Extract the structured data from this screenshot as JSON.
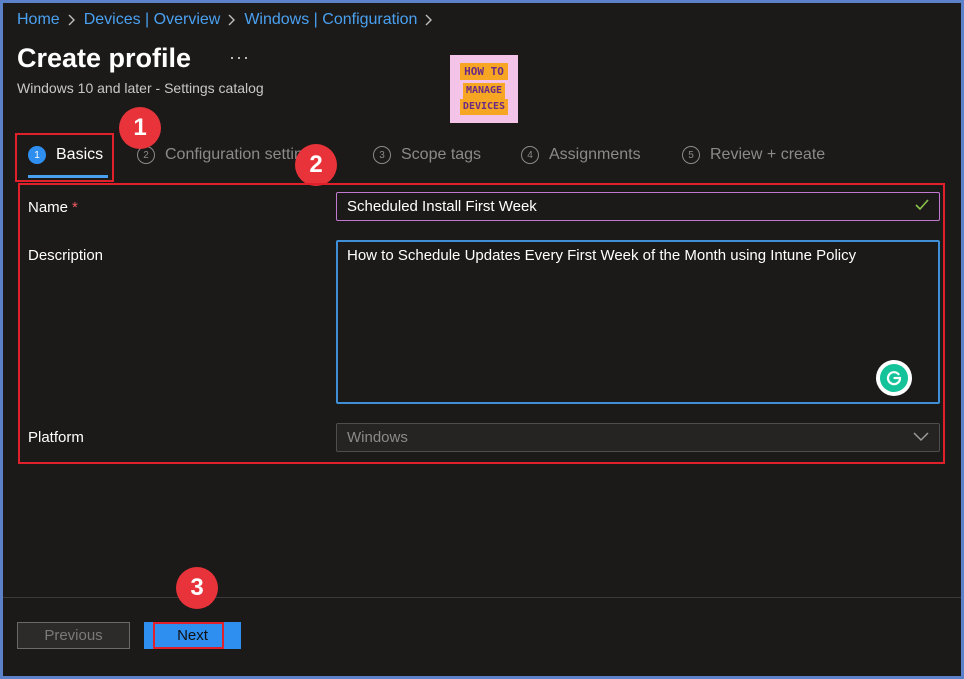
{
  "breadcrumb": [
    "Home",
    "Devices | Overview",
    "Windows | Configuration"
  ],
  "header": {
    "title": "Create profile",
    "more_label": "···",
    "subtitle": "Windows 10 and later - Settings catalog"
  },
  "logo": {
    "line1": "HOW TO",
    "line2": "MANAGE",
    "line3": "DEVICES"
  },
  "steps": [
    {
      "num": "1",
      "label": "Basics"
    },
    {
      "num": "2",
      "label": "Configuration settings"
    },
    {
      "num": "3",
      "label": "Scope tags"
    },
    {
      "num": "4",
      "label": "Assignments"
    },
    {
      "num": "5",
      "label": "Review + create"
    }
  ],
  "annotations": [
    "1",
    "2",
    "3"
  ],
  "form": {
    "name_label": "Name",
    "required_mark": "*",
    "name_value": "Scheduled Install First Week",
    "description_label": "Description",
    "description_value": "How to Schedule Updates Every First Week of the Month using Intune Policy",
    "platform_label": "Platform",
    "platform_value": "Windows"
  },
  "footer": {
    "previous_label": "Previous",
    "next_label": "Next"
  },
  "colors": {
    "accent": "#2f8ff0",
    "annotation": "#e0202a",
    "background": "#1b1a19",
    "frame": "#5b82c9"
  }
}
